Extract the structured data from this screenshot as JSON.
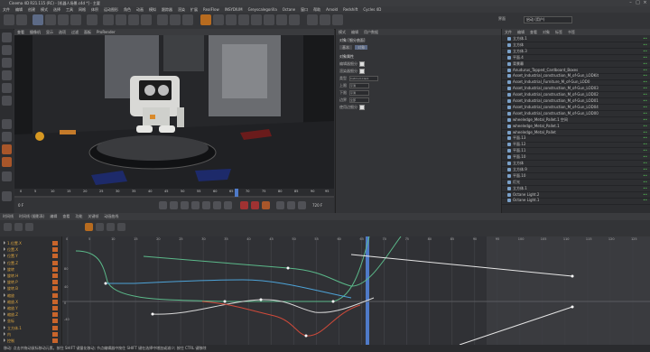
{
  "window": {
    "title": "Cinema 4D R21.115 (RC) - [机器人场景.c4d *] - 主要"
  },
  "menubar": [
    "文件",
    "编辑",
    "创建",
    "模式",
    "选择",
    "工具",
    "网格",
    "体积",
    "运动图形",
    "角色",
    "动画",
    "模拟",
    "跟踪器",
    "渲染",
    "扩展",
    "RealFlow",
    "INSYDIUM",
    "Greyscalegorilla",
    "Octane",
    "窗口",
    "帮助",
    "Arnold",
    "Redshift",
    "Cycles 4D"
  ],
  "toolbar": {
    "layout_label": "界面",
    "layout_value": "启动 (用户)",
    "colors": {
      "accent": "#b76b1f",
      "select": "#5c6a86"
    }
  },
  "viewport": {
    "menu": [
      "查看",
      "摄像机",
      "显示",
      "选项",
      "过滤",
      "面板",
      "ProRender"
    ],
    "frame_counter": "0 F",
    "frame_total": "720 F",
    "ruler_ticks": [
      "0",
      "5",
      "10",
      "15",
      "20",
      "25",
      "30",
      "35",
      "40",
      "45",
      "50",
      "55",
      "60",
      "65",
      "70",
      "75",
      "80",
      "85",
      "90",
      "95"
    ]
  },
  "attributes": {
    "tabs": [
      "模式",
      "编辑",
      "用户数据"
    ],
    "header": "对象 [细分曲面]",
    "subtabs": [
      "基本",
      "对象"
    ],
    "section": "对象属性",
    "rows": [
      {
        "label": "编辑器细分",
        "kind": "check"
      },
      {
        "label": "渲染器细分",
        "kind": "check"
      },
      {
        "label": "类型",
        "kind": "field",
        "value": "Catmull-Clark"
      },
      {
        "label": "上限",
        "kind": "field",
        "value": "平滑"
      },
      {
        "label": "下限",
        "kind": "field",
        "value": "平滑"
      },
      {
        "label": "边界",
        "kind": "field",
        "value": "全部"
      },
      {
        "label": "使用边细分",
        "kind": "check"
      }
    ]
  },
  "objects": {
    "tabs": [
      "文件",
      "编辑",
      "查看",
      "对象",
      "标签",
      "书签"
    ],
    "items": [
      "立方体.1",
      "立方体",
      "立方体.3",
      "平面.4",
      "背景幕",
      "Anudurus_Tapped_Cardboard_Boxes",
      "Asset_Industrial_construction_M_of-Gun_LODKit",
      "Asset_Industrial_Furniture_M_of-Gun_LOD0",
      "Asset_Industrial_construction_M_of-Gun_LOD03",
      "Asset_Industrial_construction_M_of-Gun_LOD02",
      "Asset_Industrial_construction_M_of-Gun_LOD01",
      "Asset_Industrial_construction_M_of-Gun_LOD04",
      "Asset_Industrial_construction_M_of-Gun_LOD00",
      "wheeledge_Metal_Pallet.1 空间",
      "wheeledge_Metal_Pallet.1",
      "wheeledge_Metal_Pallet",
      "平面.13",
      "平面.12",
      "平面.11",
      "平面.10",
      "立方体",
      "立方体.9",
      "平面.10",
      "灯光",
      "立方体.1",
      "Octane Light.2",
      "Octane Light.1"
    ]
  },
  "lower": {
    "tabs": [
      "时间线",
      "时间线 (摄影表)",
      "编辑",
      "查看",
      "功能",
      "关键帧",
      "动画曲线"
    ],
    "graph_ticks": [
      "0",
      "5",
      "10",
      "15",
      "20",
      "25",
      "30",
      "35",
      "40",
      "45",
      "50",
      "55",
      "60",
      "65",
      "70",
      "75",
      "80",
      "85",
      "90",
      "95",
      "100",
      "105",
      "110",
      "115",
      "120",
      "125"
    ],
    "tracks": [
      "1.位置.X",
      "位置.X",
      "位置.Y",
      "位置.Z",
      "旋转",
      "旋转.H",
      "旋转.P",
      "旋转.B",
      "缩放",
      "缩放.X",
      "缩放.Y",
      "缩放.Z",
      "坐标",
      "立方体.1",
      "内",
      "控制"
    ],
    "y_ticks": [
      "80",
      "40",
      "0",
      "-40"
    ]
  },
  "statusbar": "移动: 点击并拖动鼠标移动元素。按住 SHIFT 键量化移动; 节点编辑器中按住 SHIFT 键在选择中增加或减少; 按住 CTRL 键移除"
}
